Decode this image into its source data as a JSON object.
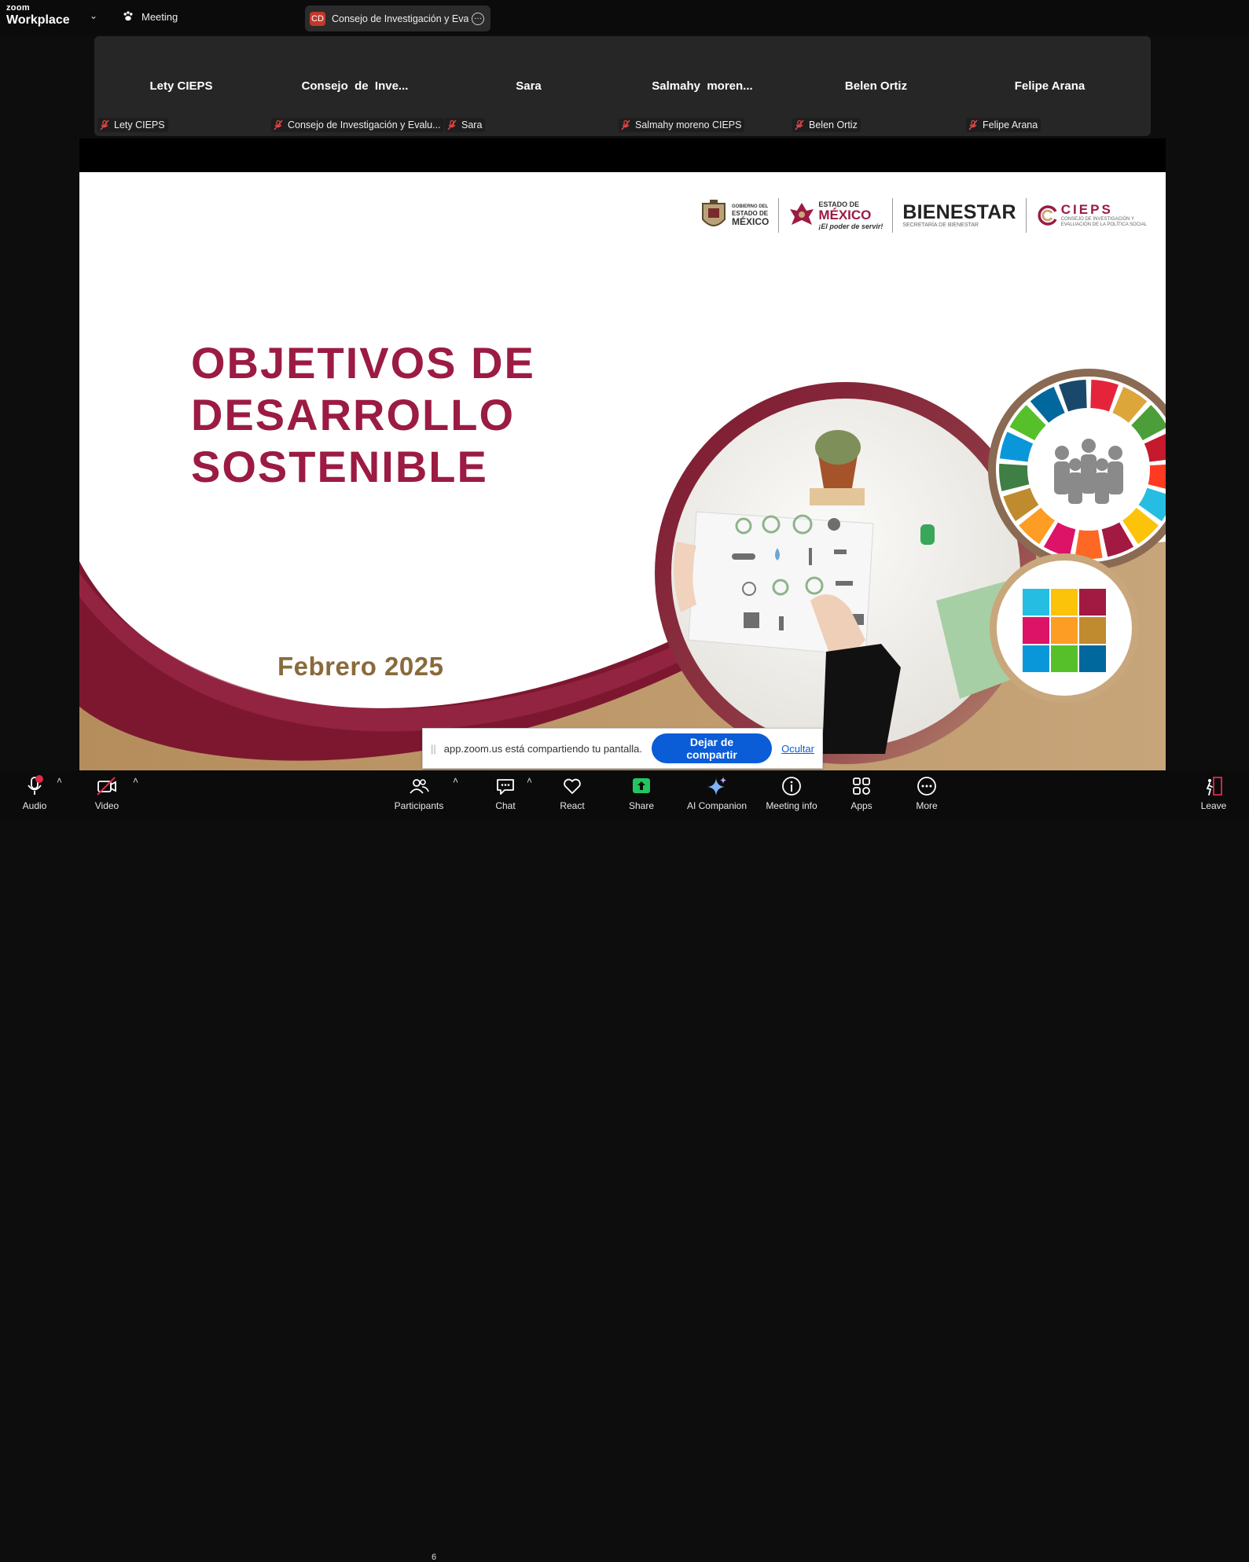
{
  "app": {
    "brand_small": "zoom",
    "brand_big": "Workplace",
    "meeting_tab_label": "Meeting",
    "share_pill": {
      "initials": "CD",
      "label": "Consejo de Investigación y Evalu"
    }
  },
  "participants": [
    {
      "display_name": "Lety CIEPS",
      "tag": "Lety CIEPS",
      "muted": true
    },
    {
      "display_name": "Consejo  de  Inve...",
      "tag": "Consejo de Investigación y Evalu...",
      "muted": true
    },
    {
      "display_name": "Sara",
      "tag": "Sara",
      "muted": true
    },
    {
      "display_name": "Salmahy  moren...",
      "tag": "Salmahy moreno CIEPS",
      "muted": true
    },
    {
      "display_name": "Belen Ortiz",
      "tag": "Belen Ortiz",
      "muted": true
    },
    {
      "display_name": "Felipe Arana",
      "tag": "Felipe Arana",
      "muted": true
    }
  ],
  "slide": {
    "logos": {
      "gob_line1": "GOBIERNO DEL",
      "gob_line2": "ESTADO DE",
      "gob_line3": "MÉXICO",
      "edomex_line1": "ESTADO DE",
      "edomex_line2": "MÉXICO",
      "edomex_line3": "¡El poder de servir!",
      "bienestar_title": "BIENESTAR",
      "bienestar_sub": "SECRETARÍA DE BIENESTAR",
      "cieps_title": "CIEPS",
      "cieps_sub1": "CONSEJO DE INVESTIGACIÓN Y",
      "cieps_sub2": "EVALUACIÓN DE LA POLÍTICA SOCIAL"
    },
    "title_line1": "OBJETIVOS DE",
    "title_line2": "DESARROLLO",
    "title_line3": "SOSTENIBLE",
    "date": "Febrero 2025",
    "colors": {
      "primary": "#9b1b43",
      "gold": "#b08a5a"
    }
  },
  "notification": {
    "message": "app.zoom.us está compartiendo tu pantalla.",
    "stop_button": "Dejar de compartir",
    "hide_link": "Ocultar"
  },
  "toolbar": {
    "audio": "Audio",
    "video": "Video",
    "participants": "Participants",
    "participants_count": "6",
    "chat": "Chat",
    "react": "React",
    "share": "Share",
    "ai_companion": "AI Companion",
    "meeting_info": "Meeting info",
    "apps": "Apps",
    "more": "More",
    "leave": "Leave"
  }
}
